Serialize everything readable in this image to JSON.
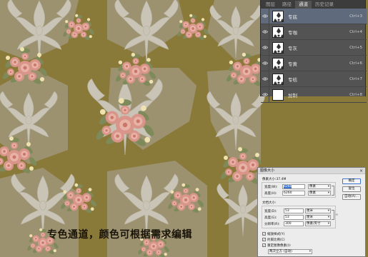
{
  "panel": {
    "tabs": [
      "图层",
      "路径",
      "通道",
      "历史记录"
    ],
    "active_tab": 2,
    "channels": [
      {
        "name": "专底",
        "shortcut": "Ctrl+3",
        "selected": true
      },
      {
        "name": "专咖",
        "shortcut": "Ctrl+4",
        "selected": false
      },
      {
        "name": "专灰",
        "shortcut": "Ctrl+5",
        "selected": false
      },
      {
        "name": "专黄",
        "shortcut": "Ctrl+6",
        "selected": false
      },
      {
        "name": "专桔",
        "shortcut": "Ctrl+7",
        "selected": false
      },
      {
        "name": "加制",
        "shortcut": "Ctrl+8",
        "selected": false
      }
    ]
  },
  "dialog": {
    "title": "图像大小",
    "close": "×",
    "image_size": "像素大小:37.4M",
    "width_label": "宽度(W):",
    "width_value": "6260",
    "width_unit": "像素",
    "height_label": "高度(H):",
    "height_value": "6260",
    "height_unit": "像素",
    "doc_size_label": "文档大小:",
    "doc_width_label": "宽度(D):",
    "doc_width_value": "53",
    "doc_width_unit": "厘米",
    "doc_height_label": "高度(G):",
    "doc_height_value": "53",
    "doc_height_unit": "厘米",
    "resolution_label": "分辨率(R):",
    "resolution_value": "300",
    "resolution_unit": "像素/英寸",
    "scale_styles": "缩放样式(Y)",
    "constrain": "约束比例(C)",
    "resample": "重定图像像素(I):",
    "resample_method": "两次立方 (自动)",
    "ok": "确定",
    "reset": "复位",
    "auto": "自动(A)..."
  },
  "caption": "专色通道，颜色可根据需求编辑",
  "colors": {
    "olive": "#8a7a3a",
    "taupe": "#9c9270",
    "rose": "#d9958a",
    "damask": "#c9c4b6"
  }
}
